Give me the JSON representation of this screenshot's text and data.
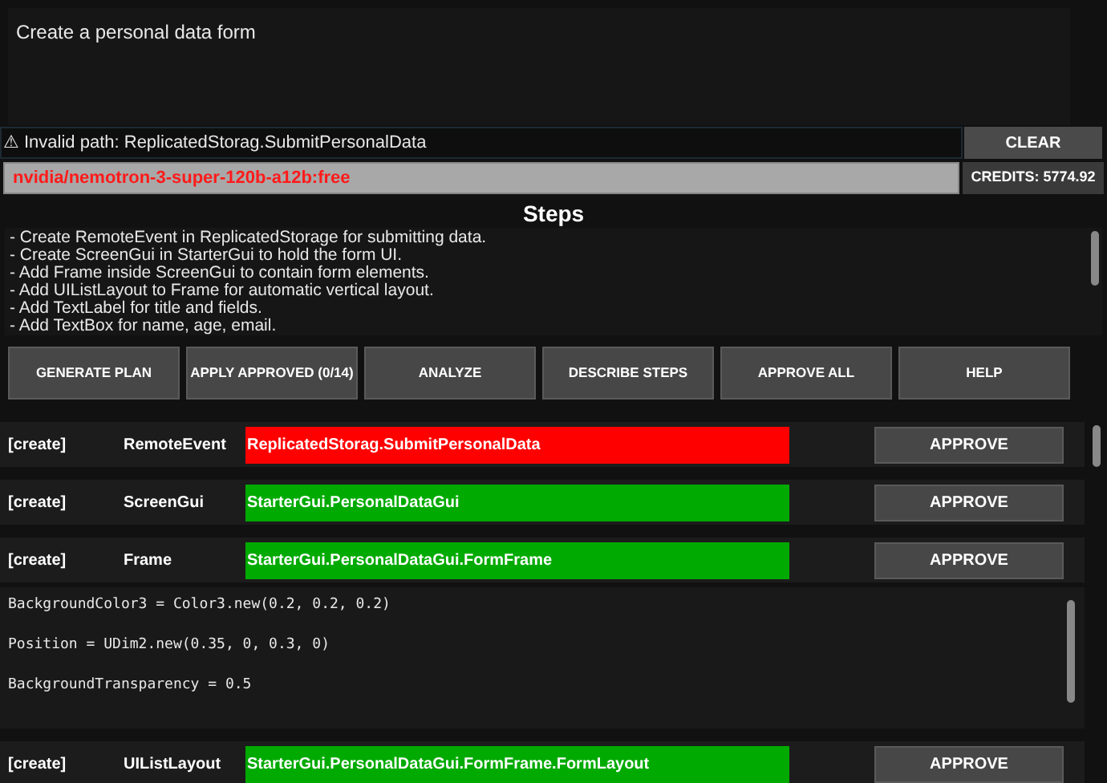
{
  "prompt": {
    "value": "Create a personal data form"
  },
  "status": {
    "icon": "⚠",
    "message": "Invalid path: ReplicatedStorag.SubmitPersonalData",
    "clear_button": "CLEAR"
  },
  "model": {
    "name": "nvidia/nemotron-3-super-120b-a12b:free",
    "credits": "CREDITS: 5774.92"
  },
  "steps": {
    "title": "Steps",
    "lines": [
      "- Create RemoteEvent in ReplicatedStorage for submitting data.",
      "- Create ScreenGui in StarterGui to hold the form UI.",
      "- Add Frame inside ScreenGui to contain form elements.",
      "- Add UIListLayout to Frame for automatic vertical layout.",
      "- Add TextLabel for title and fields.",
      "- Add TextBox for name, age, email."
    ]
  },
  "toolbar": [
    "GENERATE PLAN",
    "APPLY APPROVED (0/14)",
    "ANALYZE",
    "DESCRIBE STEPS",
    "APPROVE ALL",
    "HELP"
  ],
  "actions": [
    {
      "action": "[create]",
      "type": "RemoteEvent",
      "path": "ReplicatedStorag.SubmitPersonalData",
      "color": "#ff0000",
      "button": "APPROVE"
    },
    {
      "action": "[create]",
      "type": "ScreenGui",
      "path": "StarterGui.PersonalDataGui",
      "color": "#00aa00",
      "button": "APPROVE"
    },
    {
      "action": "[create]",
      "type": "Frame",
      "path": "StarterGui.PersonalDataGui.FormFrame",
      "color": "#00aa00",
      "button": "APPROVE",
      "properties": [
        "BackgroundColor3 = Color3.new(0.2, 0.2, 0.2)",
        "Position = UDim2.new(0.35, 0, 0.3, 0)",
        "BackgroundTransparency = 0.5"
      ]
    },
    {
      "action": "[create]",
      "type": "UIListLayout",
      "path": "StarterGui.PersonalDataGui.FormFrame.FormLayout",
      "color": "#00aa00",
      "button": "APPROVE"
    }
  ]
}
